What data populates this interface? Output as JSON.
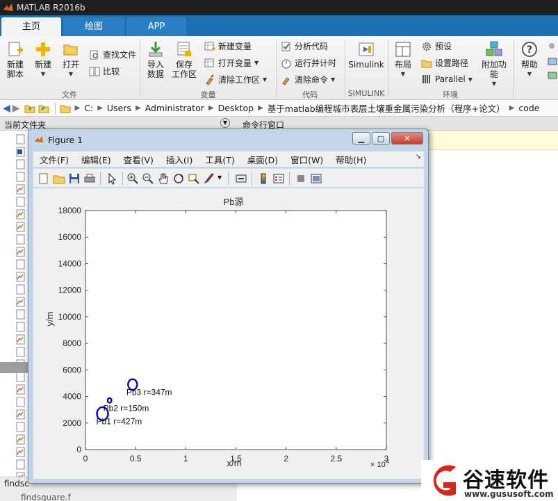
{
  "app": {
    "title": "MATLAB R2016b"
  },
  "tabs": [
    {
      "label": "主页"
    },
    {
      "label": "绘图"
    },
    {
      "label": "APP"
    }
  ],
  "ribbon": {
    "new_script": "新建\n脚本",
    "new": "新建",
    "open": "打开",
    "find_files": "查找文件",
    "compare": "比较",
    "import_data": "导入\n数据",
    "save_workspace": "保存\n工作区",
    "new_variable": "新建变量",
    "open_variable": "打开变量",
    "clear_workspace": "清除工作区",
    "analyze_code": "分析代码",
    "run_and_time": "运行并计时",
    "clear_commands": "清除命令",
    "simulink": "Simulink",
    "layout": "布局",
    "preferences": "预设",
    "set_path": "设置路径",
    "parallel": "Parallel",
    "add_ons": "附加功能",
    "help": "帮助",
    "groups": {
      "file": "文件",
      "variable": "变量",
      "code": "代码",
      "simulink": "SIMULINK",
      "environment": "环境"
    }
  },
  "address": {
    "drive": "C:",
    "parts": [
      "Users",
      "Administrator",
      "Desktop",
      "基于matlab编程城市表层土壤重金属污染分析（程序+论文）",
      "code"
    ]
  },
  "panels": {
    "current_folder": "当前文件夹",
    "command_window": "命令行窗口",
    "bottom_file": "findsc",
    "bottom_file2": "findsquare.f"
  },
  "figure": {
    "title": "Figure 1",
    "menu": [
      "文件(F)",
      "编辑(E)",
      "查看(V)",
      "插入(I)",
      "工具(T)",
      "桌面(D)",
      "窗口(W)",
      "帮助(H)"
    ]
  },
  "chart_data": {
    "type": "scatter",
    "title": "Pb源",
    "xlabel": "x/m",
    "ylabel": "y/m",
    "x_exponent": "× 10^4",
    "xlim": [
      0,
      30000
    ],
    "ylim": [
      0,
      18000
    ],
    "xticks": [
      0,
      5000,
      10000,
      15000,
      20000,
      25000,
      30000
    ],
    "xtick_labels": [
      "0",
      "0.5",
      "1",
      "1.5",
      "2",
      "2.5",
      "3"
    ],
    "yticks": [
      0,
      2000,
      4000,
      6000,
      8000,
      10000,
      12000,
      14000,
      16000,
      18000
    ],
    "ytick_labels": [
      "0",
      "2000",
      "4000",
      "6000",
      "8000",
      "10000",
      "12000",
      "14000",
      "16000",
      "18000"
    ],
    "grid": false,
    "circle_color": "#0000cc",
    "points": [
      {
        "x": 1700,
        "y": 2700,
        "r": 427,
        "label": "Pb1 r=427m"
      },
      {
        "x": 2400,
        "y": 3700,
        "r": 150,
        "label": "Pb2 r=150m"
      },
      {
        "x": 4700,
        "y": 4900,
        "r": 347,
        "label": "Pb3 r=347m"
      }
    ]
  },
  "watermark": {
    "brand": "谷速软件",
    "url": "www.gususoft.com"
  }
}
